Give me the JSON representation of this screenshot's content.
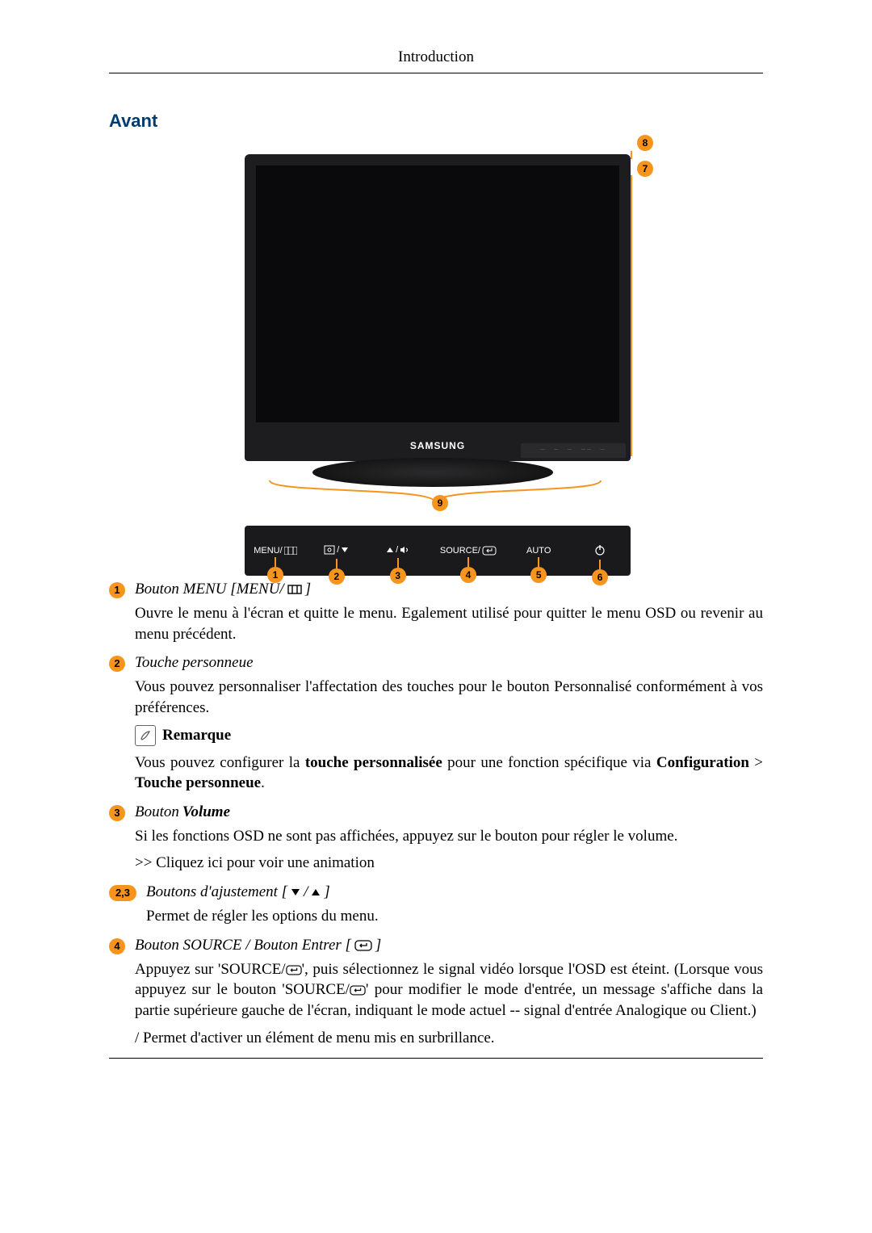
{
  "header": {
    "title": "Introduction"
  },
  "section": {
    "title": "Avant"
  },
  "figure": {
    "brand": "SAMSUNG",
    "markers": [
      "1",
      "2",
      "3",
      "4",
      "5",
      "6",
      "7",
      "8",
      "9"
    ],
    "controls": {
      "menu": "MENU/",
      "source": "SOURCE/",
      "auto": "AUTO"
    }
  },
  "entries": {
    "e1": {
      "num": "1",
      "title_pre": "Bouton MENU [MENU/",
      "title_post": "]",
      "para": "Ouvre le menu à l'écran et quitte le menu. Egalement utilisé pour quitter le menu OSD ou revenir au menu précédent."
    },
    "e2": {
      "num": "2",
      "title": "Touche personneue",
      "para": "Vous pouvez personnaliser l'affectation des touches pour le bouton Personnalisé conformément à vos préférences.",
      "note_label": "Remarque",
      "note_para_pre": "Vous pouvez configurer la ",
      "note_bold1": "touche personnalisée",
      "note_mid": " pour une fonction spécifique via ",
      "note_bold2": "Configuration",
      "note_gt": " > ",
      "note_bold3": "Touche personneue",
      "note_end": "."
    },
    "e3": {
      "num": "3",
      "title_pre": "Bouton ",
      "title_bold": "Volume",
      "para": "Si les fonctions OSD ne sont pas affichées, appuyez sur le bouton pour régler le volume.",
      "link": ">> Cliquez ici pour voir une animation"
    },
    "e23": {
      "num": "2,3",
      "title_pre": "Boutons d'ajustement [",
      "title_mid": "/",
      "title_post": "]",
      "para": "Permet de régler les options du menu."
    },
    "e4": {
      "num": "4",
      "title_pre": "Bouton SOURCE / Bouton Entrer [",
      "title_post": "]",
      "para1_pre": "Appuyez sur 'SOURCE/",
      "para1_mid": "', puis sélectionnez le signal vidéo lorsque l'OSD est éteint. (Lorsque vous appuyez sur le bouton 'SOURCE/",
      "para1_post": "' pour modifier le mode d'entrée, un message s'affiche dans la partie supérieure gauche de l'écran, indiquant le mode actuel -- signal d'entrée Analogique ou Client.)",
      "para2": "/ Permet d'activer un élément de menu mis en surbrillance."
    }
  }
}
